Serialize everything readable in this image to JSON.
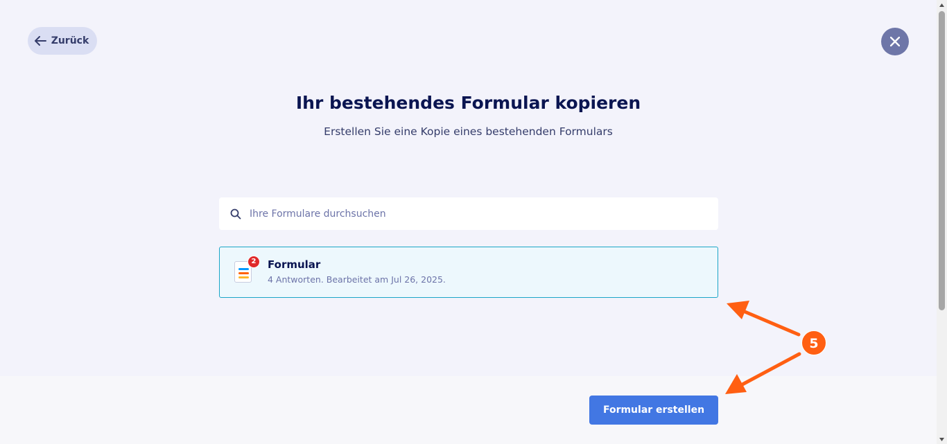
{
  "header": {
    "back_label": "Zurück"
  },
  "main": {
    "title": "Ihr bestehendes Formular kopieren",
    "subtitle": "Erstellen Sie eine Kopie eines bestehenden Formulars"
  },
  "search": {
    "placeholder": "Ihre Formulare durchsuchen",
    "value": ""
  },
  "forms": [
    {
      "name": "Formular",
      "meta": "4 Antworten. Bearbeitet am Jul 26, 2025.",
      "badge": "2",
      "selected": true
    }
  ],
  "footer": {
    "create_label": "Formular erstellen"
  },
  "annotation": {
    "step": "5",
    "color": "#ff5f12"
  },
  "colors": {
    "accent": "#4277e3",
    "selected_border": "#1aa5c7",
    "badge_red": "#e02a2a"
  },
  "icons": [
    "arrow-left-icon",
    "close-icon",
    "search-icon",
    "form-doc-icon"
  ]
}
